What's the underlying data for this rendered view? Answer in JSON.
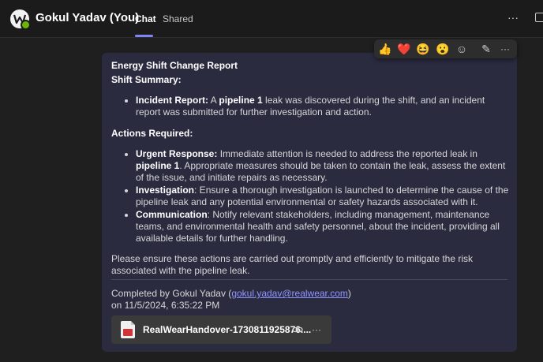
{
  "header": {
    "title": "Gokul Yadav (You)",
    "tabs": [
      {
        "label": "Chat",
        "active": true
      },
      {
        "label": "Shared",
        "active": false
      }
    ],
    "more_label": "···"
  },
  "reactions": {
    "items": [
      {
        "icon": "thumbs-up-icon",
        "glyph": "👍"
      },
      {
        "icon": "heart-icon",
        "glyph": "❤️"
      },
      {
        "icon": "laugh-icon",
        "glyph": "😆"
      },
      {
        "icon": "surprised-icon",
        "glyph": "😮"
      },
      {
        "icon": "add-reaction-icon",
        "glyph": "☺"
      },
      {
        "icon": "edit-icon",
        "glyph": "✎"
      },
      {
        "icon": "more-options-icon",
        "glyph": "···"
      }
    ]
  },
  "message": {
    "title": "Energy Shift Change Report",
    "shift_summary_heading": "Shift Summary:",
    "summary_item": {
      "label": "Incident Report:",
      "text_a": " A ",
      "bold": "pipeline 1",
      "text_b": " leak was discovered during the shift, and an incident report was submitted for further investigation and action."
    },
    "actions_heading": "Actions Required:",
    "actions": [
      {
        "label": "Urgent Response:",
        "text_a": " Immediate attention is needed to address the reported leak in ",
        "bold": "pipeline 1",
        "text_b": ". Appropriate measures should be taken to contain the leak, assess the extent of the issue, and initiate repairs as necessary."
      },
      {
        "label": "Investigation",
        "text_a": ": Ensure a thorough investigation is launched to determine the cause of the pipeline leak and any potential environmental or safety hazards associated with it."
      },
      {
        "label": "Communication",
        "text_a": ": Notify relevant stakeholders, including management, maintenance teams, and environmental health and safety personnel, about the incident, providing all available details for further handling."
      }
    ],
    "closing": "Please ensure these actions are carried out promptly and efficiently to mitigate the risk associated with the pipeline leak.",
    "completed_prefix": "Completed by Gokul Yadav (",
    "completed_email": "gokul.yadav@realwear.com",
    "completed_suffix": ")",
    "completed_date": "on 11/5/2024, 6:35:22 PM"
  },
  "attachment": {
    "file_name": "RealWearHandover-1730811925876....",
    "link_icon": "link-icon",
    "more_label": "···"
  },
  "colors": {
    "accent": "#7f85f5",
    "bubble": "#2b2b40",
    "presence": "#6bb700",
    "link": "#8f95ff"
  }
}
